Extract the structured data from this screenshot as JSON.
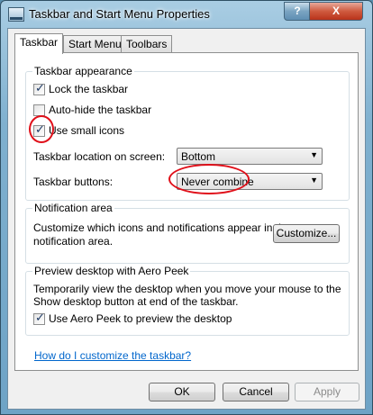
{
  "window": {
    "title": "Taskbar and Start Menu Properties",
    "help_button": "?",
    "close_button": "X"
  },
  "tabs": [
    {
      "label": "Taskbar",
      "active": true
    },
    {
      "label": "Start Menu",
      "active": false
    },
    {
      "label": "Toolbars",
      "active": false
    }
  ],
  "appearance": {
    "title": "Taskbar appearance",
    "lock": {
      "label": "Lock the taskbar",
      "checked": true
    },
    "autohide": {
      "label": "Auto-hide the taskbar",
      "checked": false
    },
    "small_icons": {
      "label": "Use small icons",
      "checked": true
    },
    "location": {
      "label": "Taskbar location on screen:",
      "value": "Bottom"
    },
    "buttons": {
      "label": "Taskbar buttons:",
      "value": "Never combine"
    }
  },
  "notification": {
    "title": "Notification area",
    "description": "Customize which icons and notifications appear in the notification area.",
    "line1": "Customize which icons and notifications appear in the",
    "line2": "notification area.",
    "customize_button": "Customize..."
  },
  "aero_peek": {
    "title": "Preview desktop with Aero Peek",
    "line1": "Temporarily view the desktop when you move your mouse to the",
    "line2": "Show desktop button at end of the taskbar.",
    "use_peek": {
      "label": "Use Aero Peek to preview the desktop",
      "checked": true
    }
  },
  "help_link": "How do I customize the taskbar?",
  "footer": {
    "ok": "OK",
    "cancel": "Cancel",
    "apply": "Apply"
  },
  "colors": {
    "annotation": "#e0101a",
    "link": "#0066cc"
  },
  "icons": {
    "checkmark": "✓",
    "dropdown": "▼"
  }
}
